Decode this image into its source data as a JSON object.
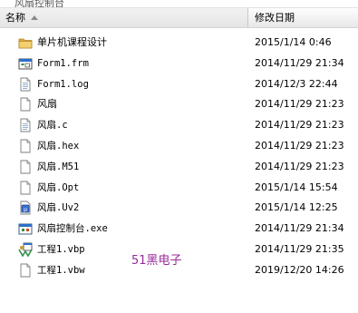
{
  "breadcrumb_fragment": "风扇控制台",
  "columns": {
    "name": "名称",
    "date": "修改日期"
  },
  "files": [
    {
      "name": "单片机课程设计",
      "date": "2015/1/14 0:46",
      "icon": "folder-icon",
      "mono": false
    },
    {
      "name": "Form1.frm",
      "date": "2014/11/29 21:34",
      "icon": "vb-form-icon",
      "mono": true
    },
    {
      "name": "Form1.log",
      "date": "2014/12/3 22:44",
      "icon": "text-file-icon",
      "mono": true
    },
    {
      "name": "风扇",
      "date": "2014/11/29 21:23",
      "icon": "blank-file-icon",
      "mono": false
    },
    {
      "name": "风扇.c",
      "date": "2014/11/29 21:23",
      "icon": "text-file-icon",
      "mono": true
    },
    {
      "name": "风扇.hex",
      "date": "2014/11/29 21:23",
      "icon": "blank-file-icon",
      "mono": true
    },
    {
      "name": "风扇.M51",
      "date": "2014/11/29 21:23",
      "icon": "blank-file-icon",
      "mono": true
    },
    {
      "name": "风扇.Opt",
      "date": "2015/1/14 15:54",
      "icon": "blank-file-icon",
      "mono": true
    },
    {
      "name": "风扇.Uv2",
      "date": "2015/1/14 12:25",
      "icon": "uvision-project-icon",
      "mono": true
    },
    {
      "name": "风扇控制台.exe",
      "date": "2014/11/29 21:34",
      "icon": "vb-exe-icon",
      "mono": true
    },
    {
      "name": "工程1.vbp",
      "date": "2014/11/29 21:35",
      "icon": "vb-project-icon",
      "mono": true
    },
    {
      "name": "工程1.vbw",
      "date": "2019/12/20 14:26",
      "icon": "blank-file-icon",
      "mono": true
    }
  ],
  "watermark": "51黑电子",
  "colors": {
    "folder": "#e8b84a",
    "watermark": "#9a2a9a",
    "vb_blue": "#2a6fc9",
    "vb_green": "#2f8f4a"
  }
}
